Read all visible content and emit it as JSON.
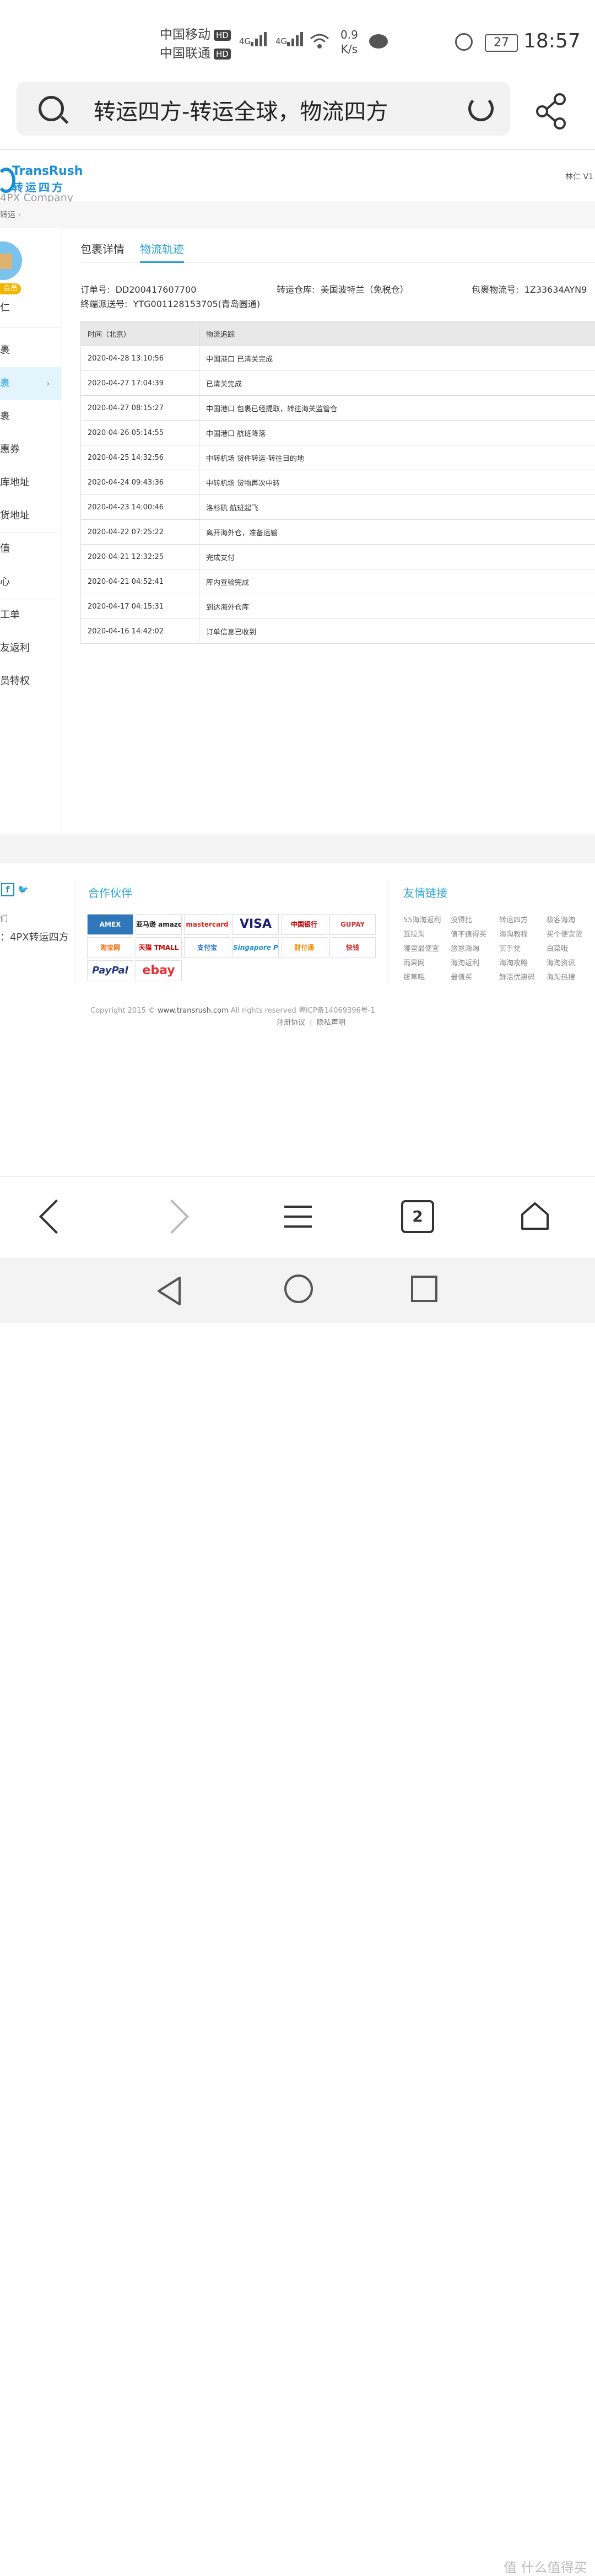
{
  "status_bar": {
    "carrier1": "中国移动",
    "carrier2": "中国联通",
    "hd": "HD",
    "net1": "4G",
    "net2": "4G",
    "speed_value": "0.9",
    "speed_unit": "K/s",
    "battery": "27",
    "time": "18:57"
  },
  "browser": {
    "address_title": "转运四方-转运全球，物流四方",
    "tabs_count": "2"
  },
  "header": {
    "logo_en": "TransRush",
    "logo_cn": "转运四方",
    "logo_sub": "4PX Company",
    "user": "林仁 V1"
  },
  "breadcrumb": "转运",
  "sidebar": {
    "vip_badge": "会员",
    "user_name": "仁",
    "items": [
      {
        "label": "裹"
      },
      {
        "label": "裹"
      },
      {
        "label": "裹"
      },
      {
        "label": "惠券"
      },
      {
        "label": "库地址"
      },
      {
        "label": "货地址"
      },
      {
        "label": "值"
      },
      {
        "label": "心"
      },
      {
        "label": "工单"
      },
      {
        "label": "友返利"
      },
      {
        "label": "员特权"
      }
    ]
  },
  "tabs": {
    "detail": "包裹详情",
    "tracking": "物流轨迹"
  },
  "order": {
    "order_no_label": "订单号:",
    "order_no": "DD200417607700",
    "warehouse_label": "转运仓库:",
    "warehouse": "美国波特兰（免税仓）",
    "tracking_label": "包裹物流号:",
    "tracking": "1Z33634AYN9",
    "final_label": "终端派送号:",
    "final": "YTG001128153705(青岛圆通)"
  },
  "table": {
    "headers": [
      "时间（北京）",
      "物流追踪"
    ],
    "rows": [
      [
        "2020-04-28 13:10:56",
        "中国港口 已清关完成"
      ],
      [
        "2020-04-27 17:04:39",
        "已清关完成"
      ],
      [
        "2020-04-27 08:15:27",
        "中国港口 包裹已经提取，转往海关监管仓"
      ],
      [
        "2020-04-26 05:14:55",
        "中国港口 航班降落"
      ],
      [
        "2020-04-25 14:32:56",
        "中转机场 货件转运-转往目的地"
      ],
      [
        "2020-04-24 09:43:36",
        "中转机场 货物再次中转"
      ],
      [
        "2020-04-23 14:00:46",
        "洛杉矶 航班起飞"
      ],
      [
        "2020-04-22 07:25:22",
        "离开海外仓，准备运输"
      ],
      [
        "2020-04-21 12:32:25",
        "完成支付"
      ],
      [
        "2020-04-21 04:52:41",
        "库内查验完成"
      ],
      [
        "2020-04-17 04:15:31",
        "到达海外仓库"
      ],
      [
        "2020-04-16 14:42:02",
        "订单信息已收到"
      ]
    ]
  },
  "footer": {
    "small_text": "们",
    "brand": "：4PX转运四方",
    "partners_title": "合作伙伴",
    "partner_logos": [
      "AMEX",
      "亚马逊 amazon",
      "mastercard",
      "VISA",
      "中国银行",
      "GUPAY",
      "淘宝网",
      "天猫 TMALL",
      "支付宝",
      "Singapore POST",
      "财付通",
      "快钱",
      "PayPal",
      "ebay"
    ],
    "links_title": "友情链接",
    "links": [
      "55海淘返利",
      "没得比",
      "转运四方",
      "极客海淘",
      "瓦拉淘",
      "值不值得买",
      "海淘教程",
      "买个便宜货",
      "哪里最便宜",
      "悠悠海淘",
      "买手党",
      "白菜哦",
      "雨果网",
      "海淘返利",
      "海淘攻略",
      "海淘资讯",
      "拔草哦",
      "最值买",
      "鲜活优惠码",
      "海淘热搜"
    ],
    "copyright_prefix": "Copyright 2015 ©",
    "copyright_site": "www.transrush.com",
    "copyright_suffix": "All rights reserved 粤ICP备14069396号-1",
    "legal1": "注册协议",
    "legal_sep": "|",
    "legal2": "隐私声明"
  },
  "watermark": "值 什么值得买"
}
